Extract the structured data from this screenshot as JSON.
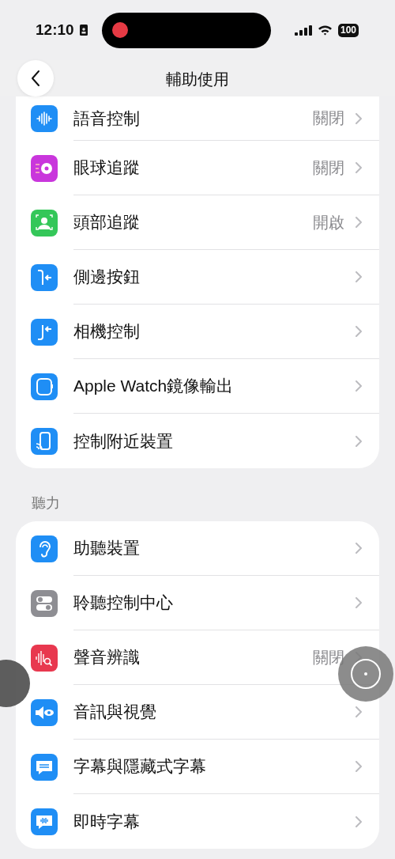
{
  "status_bar": {
    "time": "12:10",
    "battery": "100"
  },
  "nav": {
    "title": "輔助使用"
  },
  "sections": [
    {
      "rows": [
        {
          "label": "語音控制",
          "value": "關閉",
          "kind": "voice",
          "color": "#1f8ef5"
        },
        {
          "label": "眼球追蹤",
          "value": "關閉",
          "kind": "eye",
          "color": "#c936dc"
        },
        {
          "label": "頭部追蹤",
          "value": "開啟",
          "kind": "head",
          "color": "#34c759"
        },
        {
          "label": "側邊按鈕",
          "kind": "side",
          "color": "#1f8ef5"
        },
        {
          "label": "相機控制",
          "kind": "camera",
          "color": "#1f8ef5"
        },
        {
          "label": "Apple Watch鏡像輸出",
          "kind": "watch",
          "color": "#1f8ef5"
        },
        {
          "label": "控制附近裝置",
          "kind": "nearby",
          "color": "#1f8ef5"
        }
      ]
    },
    {
      "header": "聽力",
      "rows": [
        {
          "label": "助聽裝置",
          "kind": "ear",
          "color": "#1f8ef5"
        },
        {
          "label": "聆聽控制中心",
          "kind": "toggles",
          "color": "#8e8e93"
        },
        {
          "label": "聲音辨識",
          "value": "關閉",
          "kind": "sound",
          "color": "#e8384f"
        },
        {
          "label": "音訊與視覺",
          "kind": "speaker",
          "color": "#1f8ef5"
        },
        {
          "label": "字幕與隱藏式字幕",
          "kind": "caption",
          "color": "#1f8ef5"
        },
        {
          "label": "即時字幕",
          "kind": "live",
          "color": "#1f8ef5"
        }
      ]
    }
  ]
}
